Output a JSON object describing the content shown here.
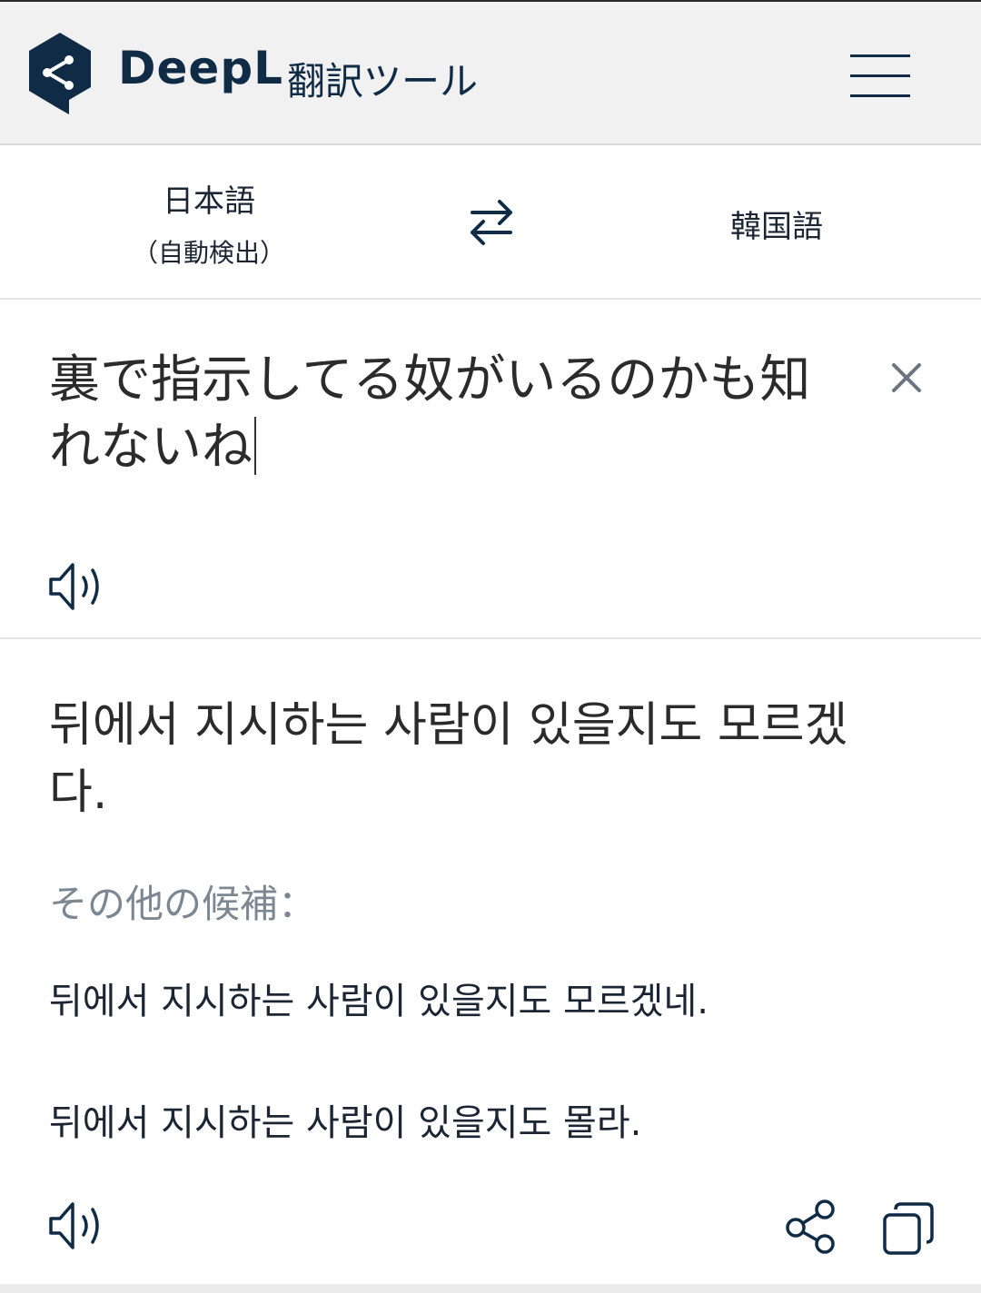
{
  "header": {
    "brand": "DeepL",
    "subtitle": "翻訳ツール",
    "logo_icon": "deepl-logo-icon",
    "menu_icon": "hamburger-menu-icon",
    "brand_color": "#0f2b46"
  },
  "languages": {
    "source_label": "日本語",
    "source_hint": "（自動検出）",
    "target_label": "韓国語",
    "swap_icon": "swap-arrows-icon"
  },
  "source": {
    "text": "裏で指示してる奴がいるのかも知れないね",
    "clear_icon": "close-icon",
    "speaker_icon": "speaker-icon"
  },
  "target": {
    "text": "뒤에서 지시하는 사람이 있을지도 모르겠다.",
    "alternatives_label": "その他の候補：",
    "alternatives": [
      "뒤에서 지시하는 사람이 있을지도 모르겠네.",
      "뒤에서 지시하는 사람이 있을지도 몰라."
    ],
    "speaker_icon": "speaker-icon",
    "share_icon": "share-icon",
    "copy_icon": "copy-icon"
  }
}
